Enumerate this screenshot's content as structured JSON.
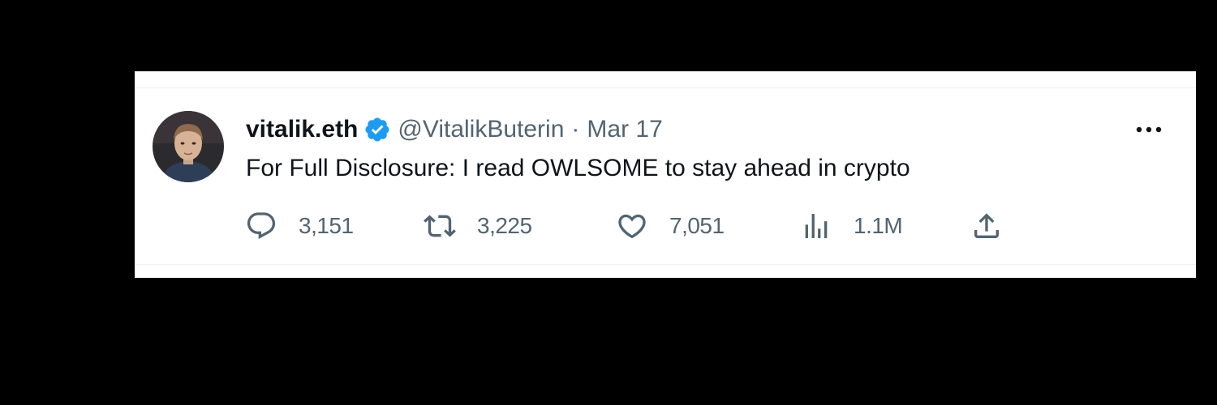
{
  "tweet": {
    "author": {
      "display_name": "vitalik.eth",
      "handle": "@VitalikButerin",
      "verified": true
    },
    "separator": "·",
    "timestamp": "Mar 17",
    "text": "For Full Disclosure: I read OWLSOME to stay ahead in crypto",
    "actions": {
      "replies": "3,151",
      "retweets": "3,225",
      "likes": "7,051",
      "views": "1.1M"
    }
  },
  "colors": {
    "background": "#000000",
    "card": "#ffffff",
    "text_primary": "#0f1419",
    "text_secondary": "#536471",
    "verified_blue": "#1d9bf0"
  },
  "icons": {
    "reply": "reply-icon",
    "retweet": "retweet-icon",
    "like": "heart-icon",
    "views": "views-chart-icon",
    "share": "share-icon",
    "more": "more-options-icon",
    "verified": "verified-badge-icon"
  }
}
